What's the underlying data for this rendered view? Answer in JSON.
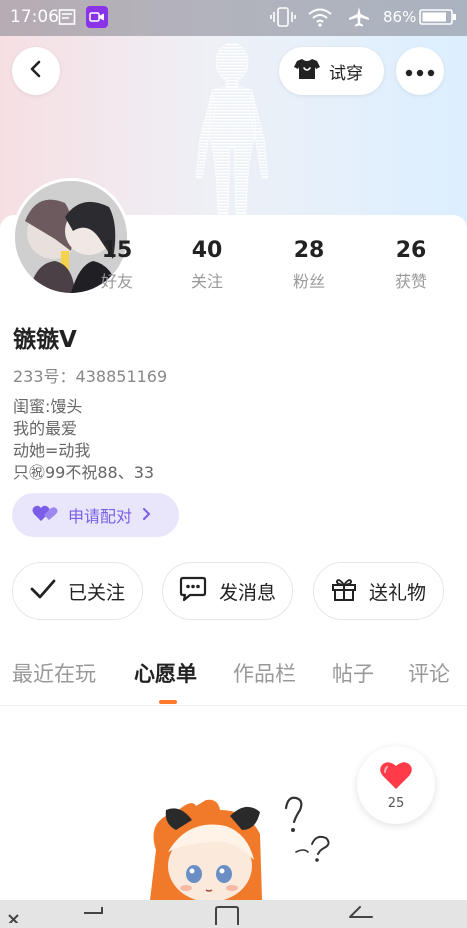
{
  "status_bar": {
    "time": "17:06",
    "battery": "86%",
    "icons": [
      "gallery-icon",
      "screen-record-icon",
      "vibrate-icon",
      "wifi-icon",
      "airplane-icon",
      "battery-icon"
    ]
  },
  "header": {
    "back_icon": "chevron-left-icon",
    "try_on_label": "试穿",
    "try_on_icon": "tshirt-icon",
    "more_icon": "more-dots-icon"
  },
  "profile": {
    "name": "镞镞V",
    "id_line": "233号：438851169",
    "bio": [
      "闺蜜:馒头",
      "我的最爱",
      "动她=动我",
      "只㊗99不祝88、33"
    ],
    "pair_label": "申请配对",
    "stats": [
      {
        "value": "15",
        "label": "好友"
      },
      {
        "value": "40",
        "label": "关注"
      },
      {
        "value": "28",
        "label": "粉丝"
      },
      {
        "value": "26",
        "label": "获赞"
      }
    ]
  },
  "actions": {
    "follow_label": "已关注",
    "message_label": "发消息",
    "gift_label": "送礼物"
  },
  "tabs": [
    {
      "label": "最近在玩",
      "active": false
    },
    {
      "label": "心愿单",
      "active": true
    },
    {
      "label": "作品栏",
      "active": false
    },
    {
      "label": "帖子",
      "active": false
    },
    {
      "label": "评论",
      "active": false
    }
  ],
  "likes_count": "25",
  "colors": {
    "accent_orange": "#ff7a2a",
    "pair_purple": "#7a5ee8",
    "like_red": "#ff3b4a"
  }
}
